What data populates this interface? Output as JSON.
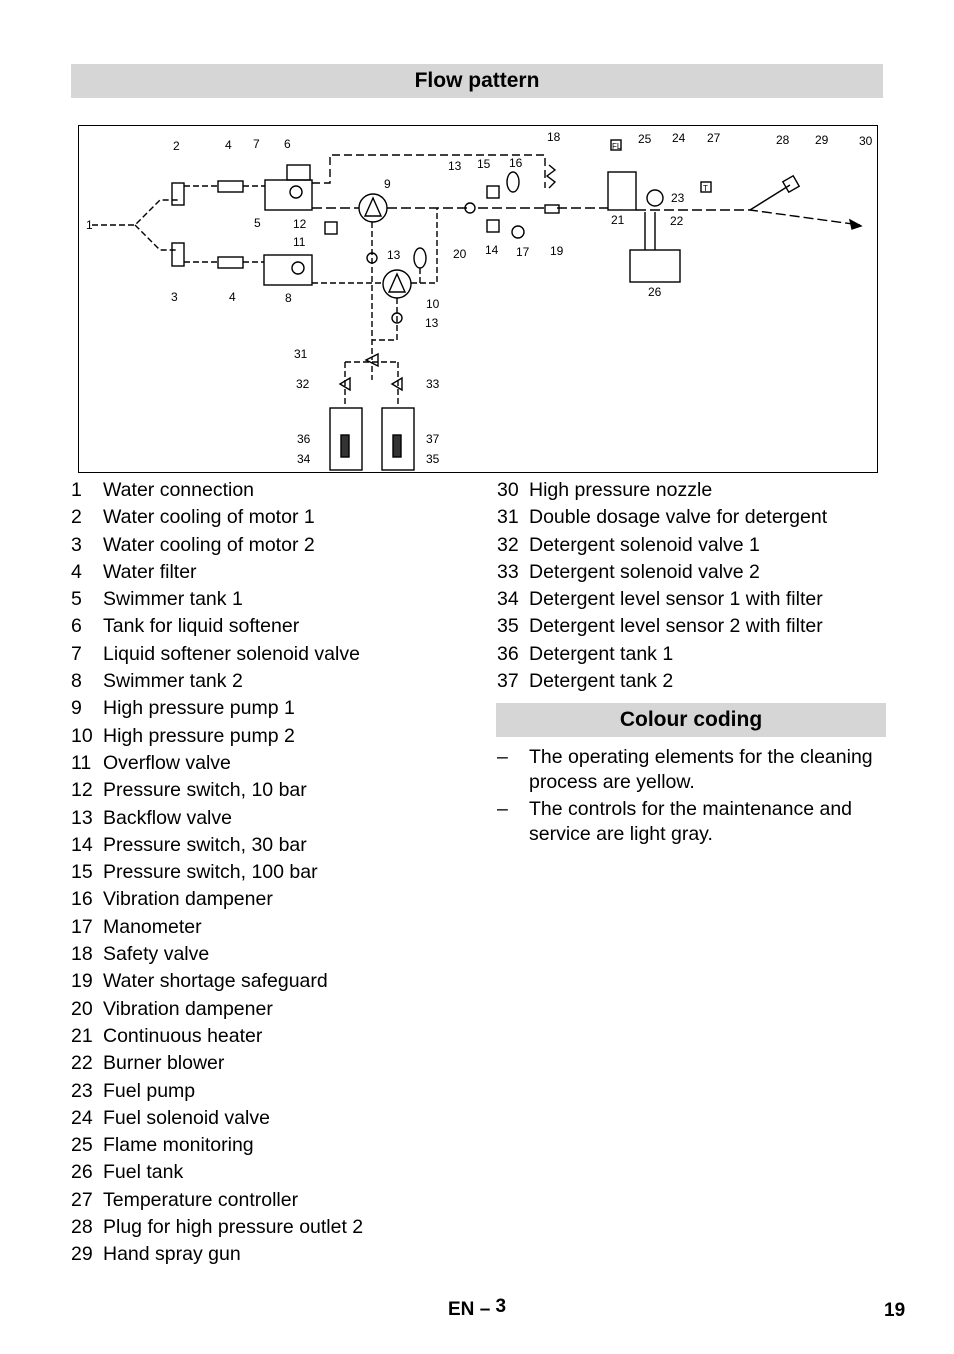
{
  "title": "Flow pattern",
  "legend_left": [
    [
      "1",
      "Water connection"
    ],
    [
      "2",
      "Water cooling of motor 1"
    ],
    [
      "3",
      "Water cooling of motor 2"
    ],
    [
      "4",
      "Water filter"
    ],
    [
      "5",
      "Swimmer tank 1"
    ],
    [
      "6",
      "Tank for liquid softener"
    ],
    [
      "7",
      "Liquid softener solenoid valve"
    ],
    [
      "8",
      "Swimmer tank 2"
    ],
    [
      "9",
      "High pressure pump 1"
    ],
    [
      "10",
      "High pressure pump 2"
    ],
    [
      "11",
      "Overflow valve"
    ],
    [
      "12",
      "Pressure switch, 10 bar"
    ],
    [
      "13",
      "Backflow valve"
    ],
    [
      "14",
      "Pressure switch, 30 bar"
    ],
    [
      "15",
      "Pressure switch, 100 bar"
    ],
    [
      "16",
      "Vibration dampener"
    ],
    [
      "17",
      "Manometer"
    ],
    [
      "18",
      "Safety valve"
    ],
    [
      "19",
      "Water shortage safeguard"
    ],
    [
      "20",
      "Vibration dampener"
    ],
    [
      "21",
      "Continuous heater"
    ],
    [
      "22",
      "Burner blower"
    ],
    [
      "23",
      "Fuel pump"
    ],
    [
      "24",
      "Fuel solenoid valve"
    ],
    [
      "25",
      "Flame monitoring"
    ],
    [
      "26",
      "Fuel tank"
    ],
    [
      "27",
      "Temperature controller"
    ],
    [
      "28",
      "Plug for high pressure outlet 2"
    ],
    [
      "29",
      "Hand spray gun"
    ]
  ],
  "legend_right": [
    [
      "30",
      "High pressure nozzle"
    ],
    [
      "31",
      "Double dosage valve for detergent"
    ],
    [
      "32",
      "Detergent solenoid valve 1"
    ],
    [
      "33",
      "Detergent solenoid valve 2"
    ],
    [
      "34",
      "Detergent level sensor 1 with filter"
    ],
    [
      "35",
      "Detergent level sensor 2 with filter"
    ],
    [
      "36",
      "Detergent tank 1"
    ],
    [
      "37",
      "Detergent tank 2"
    ]
  ],
  "colour_coding": {
    "title": "Colour coding",
    "bullets": [
      {
        "dash": "–",
        "text": "The operating elements for the cleaning process are yellow."
      },
      {
        "dash": "–",
        "text": "The controls for the maintenance and service are light gray."
      }
    ]
  },
  "diagram": {
    "labels": [
      "1",
      "2",
      "3",
      "4",
      "4",
      "5",
      "6",
      "7",
      "8",
      "9",
      "10",
      "11",
      "12",
      "13",
      "13",
      "13",
      "14",
      "15",
      "16",
      "17",
      "18",
      "19",
      "20",
      "21",
      "22",
      "23",
      "24",
      "25",
      "26",
      "27",
      "28",
      "29",
      "30",
      "31",
      "32",
      "33",
      "34",
      "35",
      "36",
      "37"
    ],
    "flame_label": "FL",
    "temp_label": "T"
  },
  "footer": {
    "lang": "EN",
    "dash": "–",
    "section": "3",
    "page": "19"
  }
}
